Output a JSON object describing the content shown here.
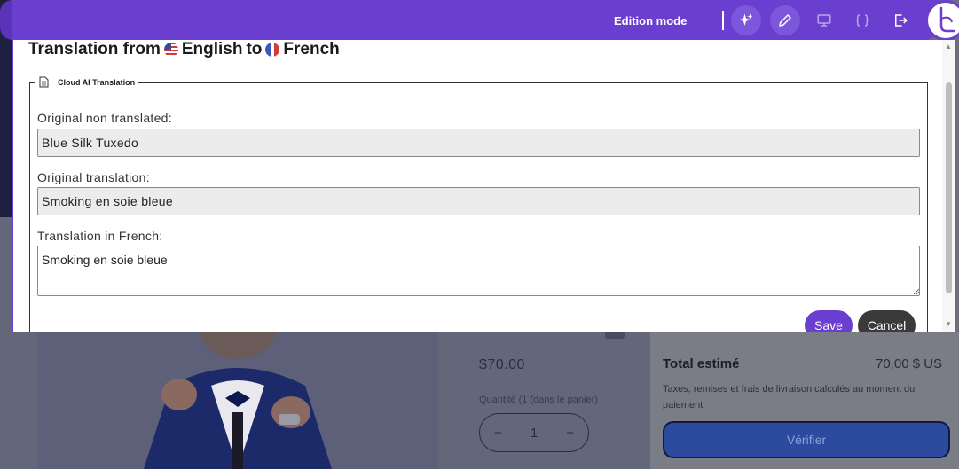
{
  "toolbar": {
    "mode_label": "Edition mode",
    "buttons": [
      {
        "name": "ai-sparkle-icon"
      },
      {
        "name": "pencil-icon"
      },
      {
        "name": "monitor-icon"
      },
      {
        "name": "code-braces-icon"
      },
      {
        "name": "logout-icon"
      }
    ],
    "accent": "#6a3fcf"
  },
  "modal": {
    "title_prefix": "Translation from",
    "source_language": "English",
    "title_connector": "to",
    "target_language": "French",
    "section_title": "Cloud AI Translation",
    "original_label": "Original non translated:",
    "original_value": "Blue Silk Tuxedo",
    "original_translation_label": "Original translation:",
    "original_translation_value": "Smoking en soie bleue",
    "translation_label": "Translation in French:",
    "translation_value": "Smoking en soie bleue",
    "save_label": "Save",
    "cancel_label": "Cancel"
  },
  "page": {
    "price": "$70.00",
    "quantity_label": "Quantité (1 (dans le panier)",
    "quantity_minus": "−",
    "quantity_value": "1",
    "quantity_plus": "+",
    "total_label": "Total estimé",
    "total_value": "70,00 $ US",
    "tax_note": "Taxes, remises et frais de livraison calculés au moment du paiement",
    "checkout_label": "Vérifier"
  }
}
